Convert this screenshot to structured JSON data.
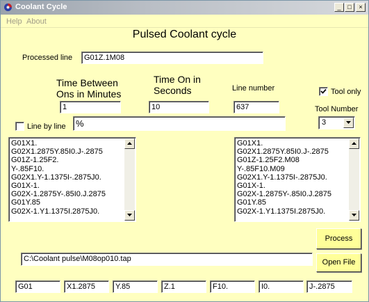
{
  "window": {
    "title": "Coolant Cycle",
    "controls": {
      "minimize": "_",
      "maximize": "□",
      "close": "×"
    }
  },
  "menu": [
    "Help",
    "About"
  ],
  "heading": "Pulsed Coolant cycle",
  "processed_line": {
    "label": "Processed line",
    "value": "G01Z.1M08"
  },
  "time_between": {
    "label_line1": "Time Between",
    "label_line2": "Ons in Minutes",
    "value": "1"
  },
  "time_on": {
    "label_line1": "Time On in",
    "label_line2": "Seconds",
    "value": "10"
  },
  "line_number": {
    "label": "Line number",
    "value": "637"
  },
  "tool_only": {
    "label": "Tool only",
    "checked": true
  },
  "tool_number": {
    "label": "Tool Number",
    "value": "3"
  },
  "line_by_line": {
    "label": "Line by line",
    "checked": false
  },
  "percent_field": {
    "value": "%"
  },
  "input_list": [
    "G01X1.",
    "G02X1.2875Y.85I0.J-.2875",
    "G01Z-1.25F2.",
    "Y-.85F10.",
    "G02X1.Y-1.1375I-.2875J0.",
    "G01X-1.",
    "G02X-1.2875Y-.85I0.J.2875",
    "G01Y.85",
    "G02X-1.Y1.1375I.2875J0."
  ],
  "output_list": [
    "G01X1.",
    "G02X1.2875Y.85I0.J-.2875",
    "G01Z-1.25F2.M08",
    "Y-.85F10.M09",
    "G02X1.Y-1.1375I-.2875J0.",
    "G01X-1.",
    "G02X-1.2875Y-.85I0.J.2875",
    "G01Y.85",
    "G02X-1.Y1.1375I.2875J0."
  ],
  "buttons": {
    "process": "Process",
    "open_file": "Open File"
  },
  "file_path": "C:\\Coolant pulse\\M08op010.tap",
  "words": [
    "G01",
    "X1.2875",
    "Y.85",
    "Z.1",
    "F10.",
    "I0.",
    "J-.2875"
  ],
  "colors": {
    "background": "#ffffc0",
    "button": "#ffff99",
    "title_text": "#ffffff"
  }
}
